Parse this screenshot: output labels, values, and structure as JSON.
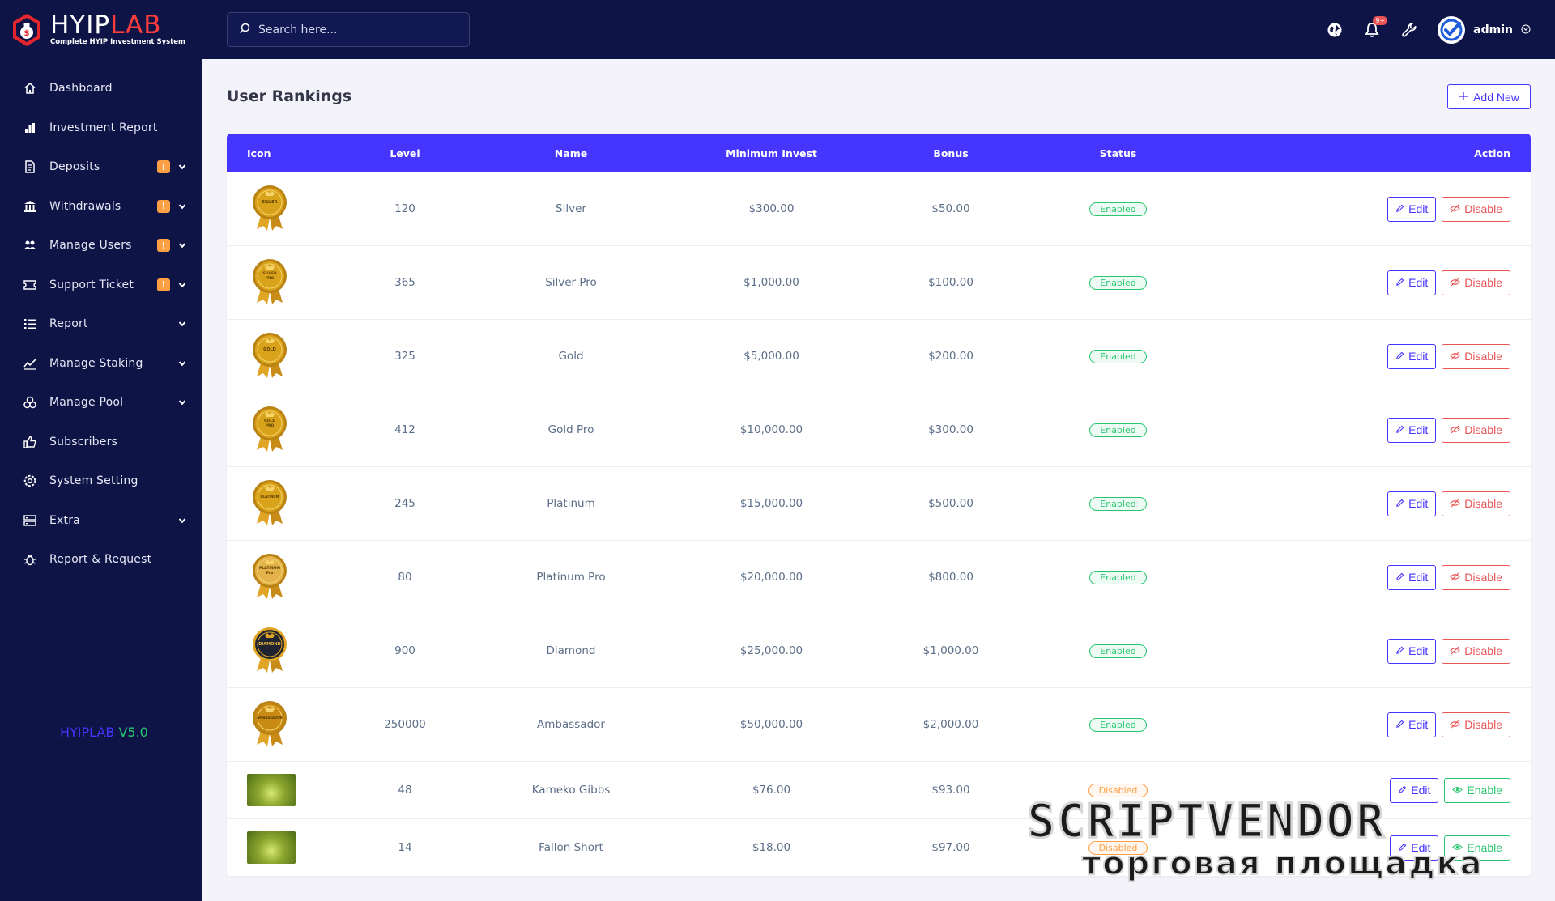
{
  "brand": {
    "name_a": "HYIP",
    "name_b": "LAB",
    "tagline": "Complete HYIP Investment System",
    "version_name": "HYIPLAB",
    "version_num": "V5.0"
  },
  "search": {
    "placeholder": "Search here..."
  },
  "topbar": {
    "notification_count": "9+",
    "admin_name": "admin"
  },
  "sidebar": {
    "items": [
      {
        "label": "Dashboard",
        "icon": "home-icon",
        "badge": "",
        "chevron": false
      },
      {
        "label": "Investment Report",
        "icon": "bar-chart-icon",
        "badge": "",
        "chevron": false
      },
      {
        "label": "Deposits",
        "icon": "document-icon",
        "badge": "!",
        "chevron": true
      },
      {
        "label": "Withdrawals",
        "icon": "bank-icon",
        "badge": "!",
        "chevron": true
      },
      {
        "label": "Manage Users",
        "icon": "users-icon",
        "badge": "!",
        "chevron": true
      },
      {
        "label": "Support Ticket",
        "icon": "ticket-icon",
        "badge": "!",
        "chevron": true
      },
      {
        "label": "Report",
        "icon": "list-icon",
        "badge": "",
        "chevron": true
      },
      {
        "label": "Manage Staking",
        "icon": "chart-line-icon",
        "badge": "",
        "chevron": true
      },
      {
        "label": "Manage Pool",
        "icon": "coins-icon",
        "badge": "",
        "chevron": true
      },
      {
        "label": "Subscribers",
        "icon": "thumbs-up-icon",
        "badge": "",
        "chevron": false
      },
      {
        "label": "System Setting",
        "icon": "settings-icon",
        "badge": "",
        "chevron": false
      },
      {
        "label": "Extra",
        "icon": "server-icon",
        "badge": "",
        "chevron": true
      },
      {
        "label": "Report & Request",
        "icon": "bug-icon",
        "badge": "",
        "chevron": false
      }
    ]
  },
  "page": {
    "title": "User Rankings",
    "add_label": "Add New"
  },
  "table": {
    "headers": {
      "icon": "Icon",
      "level": "Level",
      "name": "Name",
      "min": "Minimum Invest",
      "bonus": "Bonus",
      "status": "Status",
      "action": "Action"
    },
    "rows": [
      {
        "medal": "SILVER",
        "medal_color": "#d9a21b",
        "level": "120",
        "name": "Silver",
        "min": "$300.00",
        "bonus": "$50.00",
        "status": "Enabled",
        "toggle": "Disable"
      },
      {
        "medal": "SILVER PRO",
        "medal_color": "#d9a21b",
        "level": "365",
        "name": "Silver Pro",
        "min": "$1,000.00",
        "bonus": "$100.00",
        "status": "Enabled",
        "toggle": "Disable"
      },
      {
        "medal": "GOLD",
        "medal_color": "#d9a21b",
        "level": "325",
        "name": "Gold",
        "min": "$5,000.00",
        "bonus": "$200.00",
        "status": "Enabled",
        "toggle": "Disable"
      },
      {
        "medal": "GOLD PRO",
        "medal_color": "#d9a21b",
        "level": "412",
        "name": "Gold Pro",
        "min": "$10,000.00",
        "bonus": "$300.00",
        "status": "Enabled",
        "toggle": "Disable"
      },
      {
        "medal": "PLATINUM",
        "medal_color": "#d9a21b",
        "level": "245",
        "name": "Platinum",
        "min": "$15,000.00",
        "bonus": "$500.00",
        "status": "Enabled",
        "toggle": "Disable"
      },
      {
        "medal": "PLATINUM Pro",
        "medal_color": "#e3b24a",
        "level": "80",
        "name": "Platinum Pro",
        "min": "$20,000.00",
        "bonus": "$800.00",
        "status": "Enabled",
        "toggle": "Disable"
      },
      {
        "medal": "DIAMOND",
        "medal_color": "#1f2430",
        "level": "900",
        "name": "Diamond",
        "min": "$25,000.00",
        "bonus": "$1,000.00",
        "status": "Enabled",
        "toggle": "Disable"
      },
      {
        "medal": "AMBASSADOR",
        "medal_color": "#c98a14",
        "level": "250000",
        "name": "Ambassador",
        "min": "$50,000.00",
        "bonus": "$2,000.00",
        "status": "Enabled",
        "toggle": "Disable"
      },
      {
        "medal": "",
        "medal_color": "",
        "level": "48",
        "name": "Kameko Gibbs",
        "min": "$76.00",
        "bonus": "$93.00",
        "status": "Disabled",
        "toggle": "Enable"
      },
      {
        "medal": "",
        "medal_color": "",
        "level": "14",
        "name": "Fallon Short",
        "min": "$18.00",
        "bonus": "$97.00",
        "status": "Disabled",
        "toggle": "Enable"
      }
    ],
    "edit_label": "Edit"
  },
  "watermark": {
    "line1": "SCRIPTVENDOR",
    "line2": "торговая площадка"
  },
  "colors": {
    "sidebar_bg": "#0f1447",
    "primary": "#4634ff",
    "success": "#28c76f",
    "danger": "#ea5455",
    "warning": "#ff9f43"
  }
}
